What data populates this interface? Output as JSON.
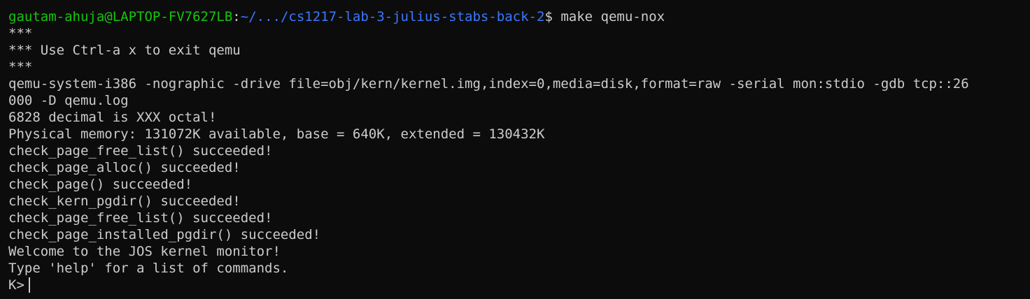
{
  "prompt": {
    "user_host": "gautam-ahuja@LAPTOP-FV7627LB",
    "separator": ":",
    "path": "~/.../cs1217-lab-3-julius-stabs-back-2",
    "dollar": "$",
    "command": " make qemu-nox"
  },
  "output_lines": [
    "***",
    "*** Use Ctrl-a x to exit qemu",
    "***",
    "qemu-system-i386 -nographic -drive file=obj/kern/kernel.img,index=0,media=disk,format=raw -serial mon:stdio -gdb tcp::26",
    "000 -D qemu.log",
    "6828 decimal is XXX octal!",
    "Physical memory: 131072K available, base = 640K, extended = 130432K",
    "check_page_free_list() succeeded!",
    "check_page_alloc() succeeded!",
    "check_page() succeeded!",
    "check_kern_pgdir() succeeded!",
    "check_page_free_list() succeeded!",
    "check_page_installed_pgdir() succeeded!",
    "Welcome to the JOS kernel monitor!",
    "Type 'help' for a list of commands."
  ],
  "monitor_prompt": "K>",
  "colors": {
    "background": "#0c0c0c",
    "text": "#cccccc",
    "user_host": "#16c60c",
    "path": "#3b78ff"
  }
}
